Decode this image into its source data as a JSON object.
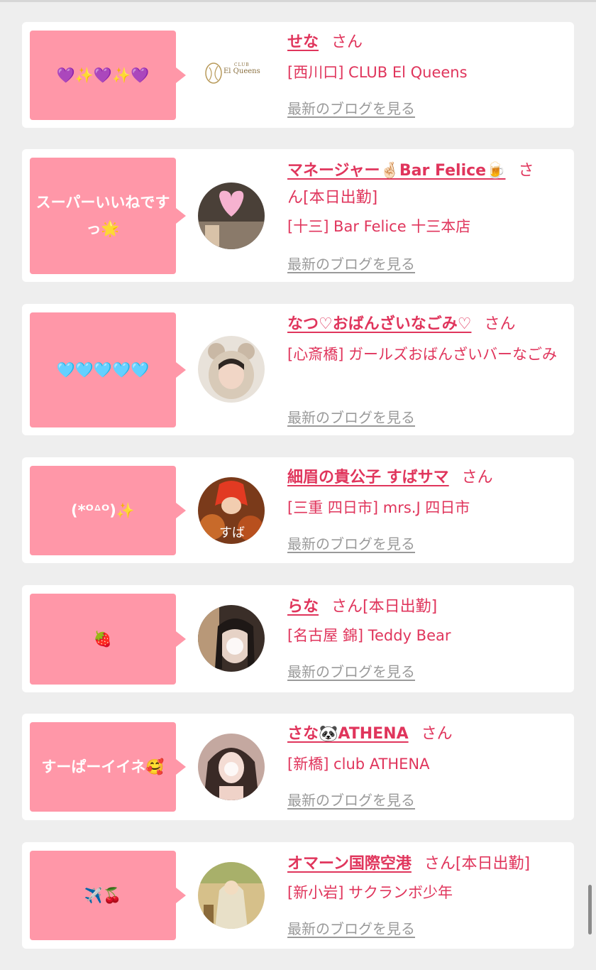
{
  "items": [
    {
      "bubble": "💜✨💜✨💜",
      "logo_text_top": "CLUB",
      "logo_text_main": "El Queens",
      "name": "せな",
      "honorific": "さん",
      "status": "",
      "shop": "[西川口] CLUB El Queens",
      "blog_link": "最新のブログを見る"
    },
    {
      "bubble": "スーパーいいねですっ🌟",
      "name": "マネージャー🤞🏻Bar Felice🍺",
      "honorific": "さ",
      "status": "ん[本日出勤]",
      "shop": "[十三] Bar Felice 十三本店",
      "blog_link": "最新のブログを見る"
    },
    {
      "bubble": "🩵🩵🩵🩵🩵",
      "name": "なつ♡おばんざいなごみ♡",
      "honorific": "さん",
      "status": "",
      "shop": "[心斎橋] ガールズおばんざいバーなごみ",
      "blog_link": "最新のブログを見る"
    },
    {
      "bubble": "(*ᴼᐞᴼ)✨",
      "name": "細眉の貴公子 すばサマ",
      "honorific": "さん",
      "status": "",
      "shop": "[三重 四日市] mrs.J 四日市",
      "blog_link": "最新のブログを見る"
    },
    {
      "bubble": "🍓",
      "name": "らな",
      "honorific": "さん",
      "status": "[本日出勤]",
      "shop": "[名古屋 錦] Teddy Bear",
      "blog_link": "最新のブログを見る"
    },
    {
      "bubble": "すーぱーイイネ🥰",
      "name": "さな🐼ATHENA",
      "honorific": "さん",
      "status": "",
      "shop": "[新橋] club ATHENA",
      "blog_link": "最新のブログを見る"
    },
    {
      "bubble": "✈️🍒",
      "name": "オマーン国際空港",
      "honorific": "さん",
      "status": "[本日出勤]",
      "shop": "[新小岩] サクランボ少年",
      "blog_link": "最新のブログを見る"
    }
  ],
  "colors": {
    "accent": "#e0355c",
    "bubble": "#ff97a8",
    "link_gray": "#9a9a9a",
    "background": "#eeeeee"
  }
}
